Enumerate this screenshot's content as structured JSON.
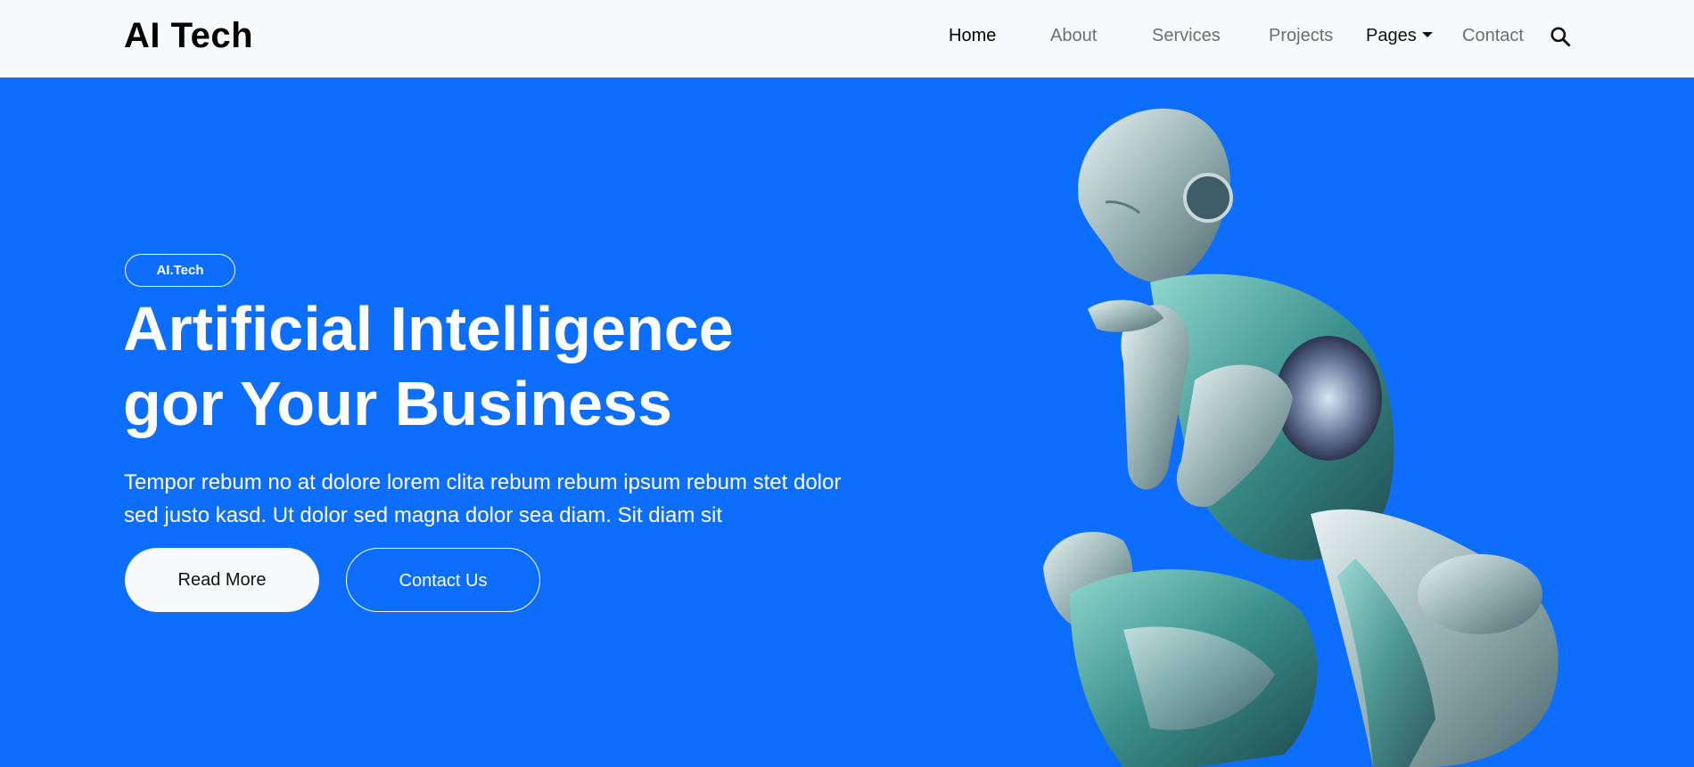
{
  "brand": {
    "name": "AI Tech"
  },
  "nav": {
    "items": [
      {
        "label": "Home",
        "state": "active"
      },
      {
        "label": "About"
      },
      {
        "label": "Services"
      },
      {
        "label": "Projects"
      },
      {
        "label": "Pages",
        "dropdown": true
      },
      {
        "label": "Contact"
      }
    ],
    "search_icon": "search-icon"
  },
  "hero": {
    "badge": "AI.Tech",
    "title_line1": "Artificial Intelligence",
    "title_line2": "gor Your Business",
    "description": "Tempor rebum no at dolore lorem clita rebum rebum ipsum rebum stet dolor sed justo kasd. Ut dolor sed magna dolor sea diam. Sit diam sit",
    "read_more_label": "Read More",
    "contact_label": "Contact Us"
  },
  "colors": {
    "hero_bg": "#0d6efd",
    "navbar_bg": "#f8f9fa",
    "text_on_hero": "#ffffff"
  }
}
